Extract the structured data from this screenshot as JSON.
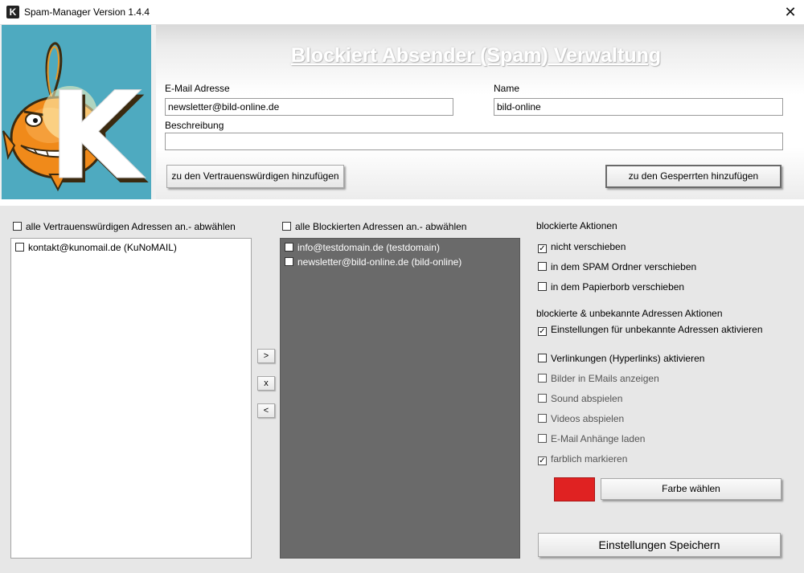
{
  "window": {
    "title": "Spam-Manager Version 1.4.4",
    "icon": "K",
    "close_glyph": "✕"
  },
  "header": {
    "title": "Blockiert Absender (Spam) Verwaltung",
    "logo_letter": "K",
    "email_label": "E-Mail Adresse",
    "email_value": "newsletter@bild-online.de",
    "name_label": "Name",
    "name_value": "bild-online",
    "description_label": "Beschreibung",
    "description_value": "",
    "add_trusted_label": "zu den Vertrauenswürdigen hinzufügen",
    "add_blocked_label": "zu den Gesperrten hinzufügen"
  },
  "trusted": {
    "select_all_label": "alle Vertrauenswürdigen Adressen an.- abwählen",
    "items": [
      {
        "label": "kontakt@kunomail.de (KuNoMAIL)",
        "checked": false
      }
    ]
  },
  "blocked": {
    "select_all_label": "alle Blockierten Adressen an.- abwählen",
    "items": [
      {
        "label": "info@testdomain.de (testdomain)",
        "checked": false
      },
      {
        "label": "newsletter@bild-online.de (bild-online)",
        "checked": false
      }
    ]
  },
  "transfer": {
    "move_right": ">",
    "delete": "x",
    "move_left": "<"
  },
  "actions": {
    "blocked_heading": "blockierte Aktionen",
    "blocked_options": [
      {
        "label": "nicht verschieben",
        "checked": true
      },
      {
        "label": "in dem SPAM Ordner verschieben",
        "checked": false
      },
      {
        "label": "in dem Papierborb verschieben",
        "checked": false
      }
    ],
    "unknown_heading": "blockierte & unbekannte Adressen Aktionen",
    "enable_unknown": {
      "label": "Einstellungen für unbekannte Adressen aktivieren",
      "checked": true
    },
    "unknown_options": [
      {
        "label": "Verlinkungen (Hyperlinks) aktivieren",
        "checked": false,
        "enabled": true
      },
      {
        "label": "Bilder in EMails anzeigen",
        "checked": false,
        "enabled": false
      },
      {
        "label": "Sound abspielen",
        "checked": false,
        "enabled": false
      },
      {
        "label": "Videos abspielen",
        "checked": false,
        "enabled": false
      },
      {
        "label": "E-Mail Anhänge laden",
        "checked": false,
        "enabled": false
      },
      {
        "label": "farblich markieren",
        "checked": true,
        "enabled": false
      }
    ],
    "color_value": "#e02222",
    "choose_color_label": "Farbe wählen",
    "save_label": "Einstellungen Speichern"
  },
  "colors": {
    "logo_bg": "#4eaac0",
    "blocked_list_bg": "#6a6a6a",
    "disabled_text": "#555555"
  }
}
